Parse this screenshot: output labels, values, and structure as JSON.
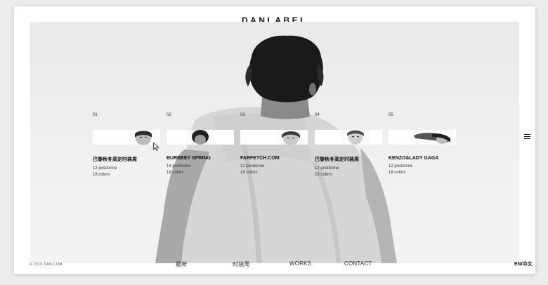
{
  "brand": "DANLABEL",
  "collections": [
    {
      "number": "01",
      "title": "巴黎秋冬高定时装周",
      "positions": "12 postionne",
      "colors": "18 colors"
    },
    {
      "number": "02",
      "title": "BURBEEY SPRING",
      "positions": "14 postionne",
      "colors": "18 colors"
    },
    {
      "number": "03",
      "title": "FARFETCH.COM",
      "positions": "12 postionne",
      "colors": "18 colors"
    },
    {
      "number": "04",
      "title": "巴黎秋冬高定时装周",
      "positions": "12 postionne",
      "colors": "18 colors"
    },
    {
      "number": "05",
      "title": "KENZO&LADY GAGA",
      "positions": "12 postionne",
      "colors": "18 colors"
    }
  ],
  "footer": {
    "copyright": "© 2016 DAN.COM",
    "nav": [
      "最新",
      "时装周",
      "WORKS",
      "CONTACT"
    ],
    "language": "EN/中文"
  },
  "icons": {
    "menu": "hamburger-menu-icon",
    "cursor": "mouse-pointer-icon"
  }
}
